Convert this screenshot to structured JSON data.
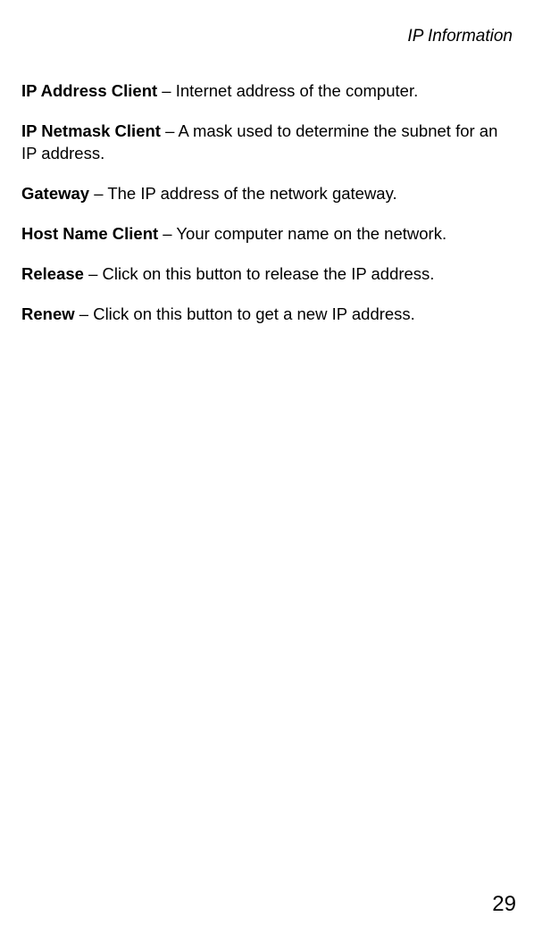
{
  "header": "IP Information",
  "entries": [
    {
      "term": "IP Address Client",
      "desc": " – Internet address of the computer."
    },
    {
      "term": "IP Netmask Client",
      "desc": " – A mask used to determine the subnet for an IP address."
    },
    {
      "term": "Gateway",
      "desc": " – The IP address of the network gateway."
    },
    {
      "term": "Host Name Client",
      "desc": " – Your computer name on the network."
    },
    {
      "term": "Release",
      "desc": " – Click on this button to release the IP address."
    },
    {
      "term": "Renew",
      "desc": " – Click on this button to get a new IP address."
    }
  ],
  "pageNumber": "29"
}
